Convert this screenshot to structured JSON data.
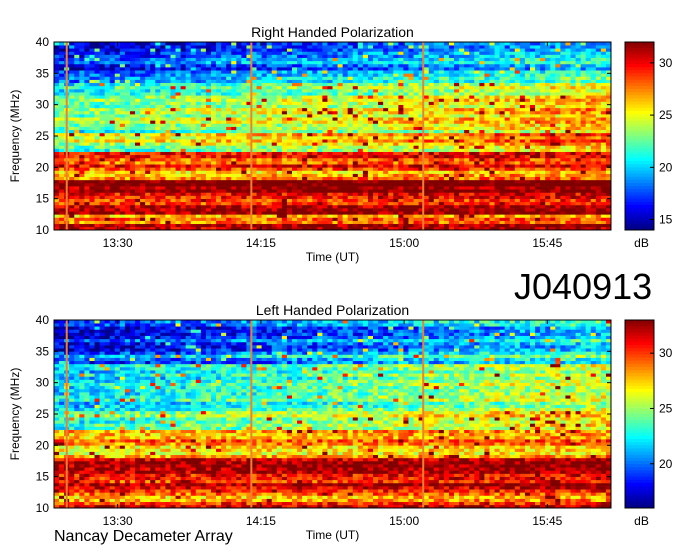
{
  "chart_data": [
    {
      "type": "heatmap",
      "title": "Right Handed Polarization",
      "xlabel": "Time (UT)",
      "ylabel": "Frequency (MHz)",
      "x_ticks": [
        "13:30",
        "14:15",
        "15:00",
        "15:45"
      ],
      "x_range": [
        "13:10",
        "16:05"
      ],
      "y_ticks": [
        10,
        15,
        20,
        25,
        30,
        35,
        40
      ],
      "ylim": [
        10,
        40
      ],
      "colorbar": {
        "label": "dB",
        "ticks": [
          15,
          20,
          25,
          30
        ],
        "range": [
          14,
          32
        ],
        "colormap": "jet"
      },
      "bands": [
        {
          "f": [
            10.0,
            11.0
          ],
          "level": 30
        },
        {
          "f": [
            11.0,
            12.5
          ],
          "level": 27
        },
        {
          "f": [
            12.5,
            14.0
          ],
          "level": 31
        },
        {
          "f": [
            14.0,
            15.5
          ],
          "level": 28
        },
        {
          "f": [
            15.5,
            18.0
          ],
          "level": 31
        },
        {
          "f": [
            18.0,
            19.5
          ],
          "level": 26
        },
        {
          "f": [
            19.5,
            21.5
          ],
          "level": 29
        },
        {
          "f": [
            21.5,
            22.5
          ],
          "level": 30
        },
        {
          "f": [
            22.5,
            24.0
          ],
          "level": 22
        },
        {
          "f": [
            24.0,
            25.5
          ],
          "level": 24
        },
        {
          "f": [
            25.5,
            27.0
          ],
          "level": 21
        },
        {
          "f": [
            27.0,
            29.0
          ],
          "level": 23
        },
        {
          "f": [
            29.0,
            31.0
          ],
          "level": 22
        },
        {
          "f": [
            31.0,
            33.0
          ],
          "level": 21
        },
        {
          "f": [
            33.0,
            35.0
          ],
          "level": 19
        },
        {
          "f": [
            35.0,
            40.0
          ],
          "level": 16.5
        }
      ],
      "vertical_lines": [
        "13:14",
        "14:12",
        "15:06"
      ],
      "trend_db_per_hour": 1.5
    },
    {
      "type": "heatmap",
      "title": "Left Handed Polarization",
      "xlabel": "Time (UT)",
      "ylabel": "Frequency (MHz)",
      "x_ticks": [
        "13:30",
        "14:15",
        "15:00",
        "15:45"
      ],
      "x_range": [
        "13:10",
        "16:05"
      ],
      "y_ticks": [
        10,
        15,
        20,
        25,
        30,
        35,
        40
      ],
      "ylim": [
        10,
        40
      ],
      "colorbar": {
        "label": "dB",
        "ticks": [
          20,
          25,
          30
        ],
        "range": [
          16,
          33
        ],
        "colormap": "jet"
      },
      "bands": [
        {
          "f": [
            10.0,
            11.0
          ],
          "level": 31
        },
        {
          "f": [
            11.0,
            12.5
          ],
          "level": 28
        },
        {
          "f": [
            12.5,
            14.0
          ],
          "level": 31
        },
        {
          "f": [
            14.0,
            15.5
          ],
          "level": 29
        },
        {
          "f": [
            15.5,
            18.0
          ],
          "level": 31
        },
        {
          "f": [
            18.0,
            19.5
          ],
          "level": 27
        },
        {
          "f": [
            19.5,
            21.5
          ],
          "level": 28
        },
        {
          "f": [
            21.5,
            22.5
          ],
          "level": 29
        },
        {
          "f": [
            22.5,
            24.0
          ],
          "level": 23
        },
        {
          "f": [
            24.0,
            25.5
          ],
          "level": 24
        },
        {
          "f": [
            25.5,
            27.0
          ],
          "level": 22
        },
        {
          "f": [
            27.0,
            29.0
          ],
          "level": 23
        },
        {
          "f": [
            29.0,
            31.0
          ],
          "level": 22
        },
        {
          "f": [
            31.0,
            33.0
          ],
          "level": 21
        },
        {
          "f": [
            33.0,
            35.0
          ],
          "level": 19.5
        },
        {
          "f": [
            35.0,
            40.0
          ],
          "level": 18
        }
      ],
      "vertical_lines": [
        "13:14",
        "14:12",
        "15:06"
      ],
      "trend_db_per_hour": 1.5
    }
  ],
  "observation_code": "J040913",
  "instrument": "Nancay Decameter Array"
}
